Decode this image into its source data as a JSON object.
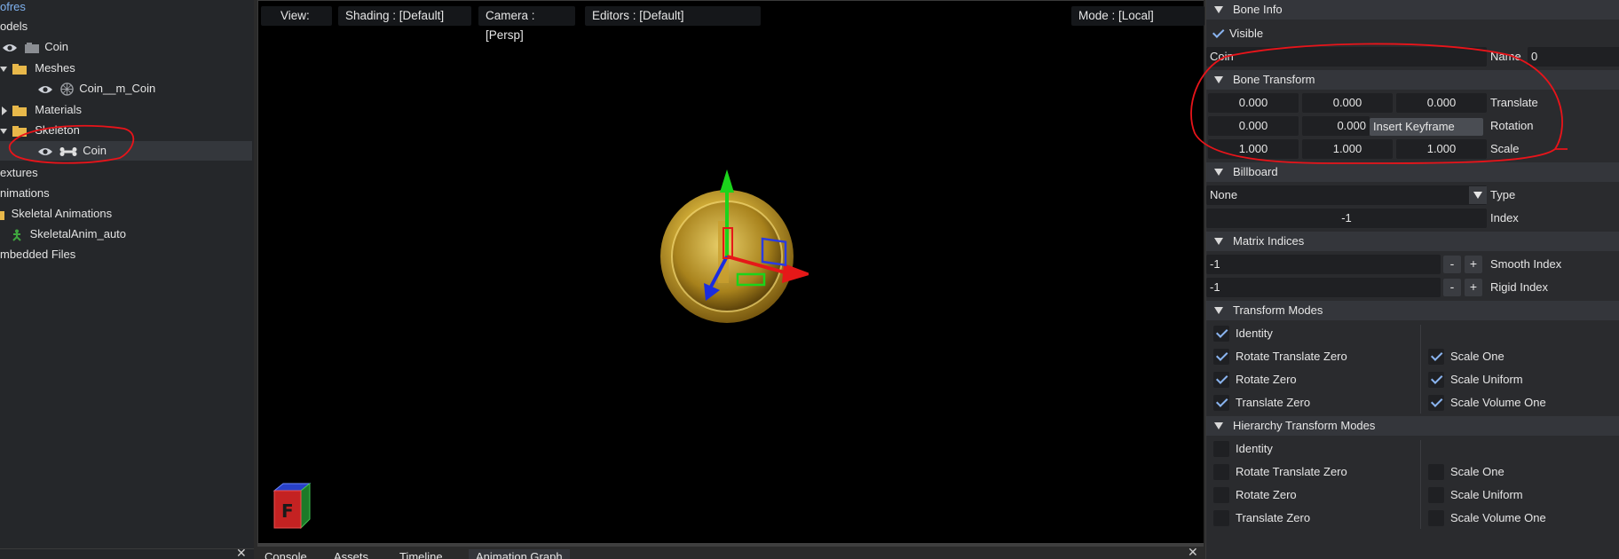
{
  "outliner": {
    "root": "ofres",
    "models": "odels",
    "model_coin": "Coin",
    "meshes": "Meshes",
    "mesh_item": "Coin__m_Coin",
    "materials": "Materials",
    "skeleton": "Skeleton",
    "bone_coin": "Coin",
    "textures": "extures",
    "animations": "nimations",
    "skeletal_animations": "Skeletal Animations",
    "skel_anim_item": "SkeletalAnim_auto",
    "embedded_files": "mbedded Files"
  },
  "viewport": {
    "view": "View:",
    "shading": "Shading : [Default]",
    "camera": "Camera : [Persp]",
    "editors": "Editors : [Default]",
    "mode": "Mode : [Local]"
  },
  "bottom_tabs": [
    "Console",
    "Assets",
    "Timeline",
    "Animation Graph"
  ],
  "props": {
    "bone_info": {
      "header": "Bone Info",
      "visible_label": "Visible",
      "visible": true,
      "name_value": "Coin",
      "name_label": "Name",
      "index_value": "0"
    },
    "bone_transform": {
      "header": "Bone Transform",
      "translate": [
        "0.000",
        "0.000",
        "0.000"
      ],
      "translate_label": "Translate",
      "rotation": [
        "0.000",
        "0.000"
      ],
      "insert_keyframe": "Insert Keyframe",
      "rotation_label": "Rotation",
      "scale": [
        "1.000",
        "1.000",
        "1.000"
      ],
      "scale_label": "Scale"
    },
    "billboard": {
      "header": "Billboard",
      "type_value": "None",
      "type_label": "Type",
      "index_value": "-1",
      "index_label": "Index"
    },
    "matrix_indices": {
      "header": "Matrix Indices",
      "smooth_value": "-1",
      "smooth_label": "Smooth Index",
      "rigid_value": "-1",
      "rigid_label": "Rigid Index",
      "minus": "-",
      "plus": "+"
    },
    "transform_modes": {
      "header": "Transform Modes",
      "identity": "Identity",
      "rotate_translate_zero": "Rotate Translate Zero",
      "rotate_zero": "Rotate Zero",
      "translate_zero": "Translate Zero",
      "scale_one": "Scale One",
      "scale_uniform": "Scale Uniform",
      "scale_volume_one": "Scale Volume One",
      "checked": {
        "identity": true,
        "rotate_translate_zero": true,
        "rotate_zero": true,
        "translate_zero": true,
        "scale_one": true,
        "scale_uniform": true,
        "scale_volume_one": true
      }
    },
    "hierarchy_transform_modes": {
      "header": "Hierarchy Transform Modes",
      "identity": "Identity",
      "rotate_translate_zero": "Rotate Translate Zero",
      "rotate_zero": "Rotate Zero",
      "translate_zero": "Translate Zero",
      "scale_one": "Scale One",
      "scale_uniform": "Scale Uniform",
      "scale_volume_one": "Scale Volume One",
      "checked": {
        "identity": false,
        "rotate_translate_zero": false,
        "rotate_zero": false,
        "translate_zero": false,
        "scale_one": false,
        "scale_uniform": false,
        "scale_volume_one": false
      }
    }
  },
  "gizmo": {
    "cube_label": "F"
  },
  "colors": {
    "accent": "#8ab4f0",
    "annotation": "#e8141a",
    "gold": "#d4b02a"
  }
}
